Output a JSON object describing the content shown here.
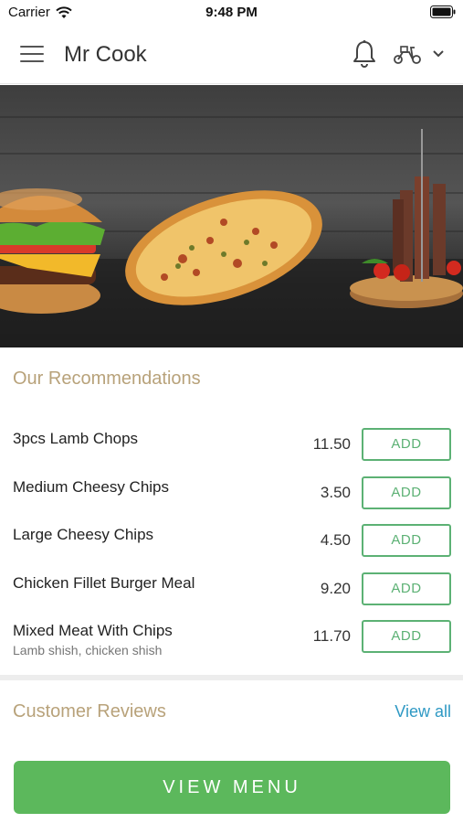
{
  "status_bar": {
    "carrier": "Carrier",
    "time": "9:48 PM"
  },
  "header": {
    "title": "Mr Cook"
  },
  "recommendations": {
    "title": "Our Recommendations",
    "items": [
      {
        "name": "3pcs Lamb Chops",
        "subtitle": "",
        "price": "11.50",
        "button": "ADD"
      },
      {
        "name": "Medium Cheesy Chips",
        "subtitle": "",
        "price": "3.50",
        "button": "ADD"
      },
      {
        "name": "Large Cheesy Chips",
        "subtitle": "",
        "price": "4.50",
        "button": "ADD"
      },
      {
        "name": "Chicken Fillet Burger Meal",
        "subtitle": "",
        "price": "9.20",
        "button": "ADD"
      },
      {
        "name": "Mixed Meat With Chips",
        "subtitle": "Lamb shish, chicken shish",
        "price": "11.70",
        "button": "ADD"
      }
    ]
  },
  "reviews": {
    "title": "Customer Reviews",
    "view_all": "View all"
  },
  "footer": {
    "view_menu": "VIEW MENU"
  },
  "colors": {
    "accent_green": "#5cb85c",
    "heading_tan": "#b8a27a",
    "link_blue": "#2f99c4"
  }
}
